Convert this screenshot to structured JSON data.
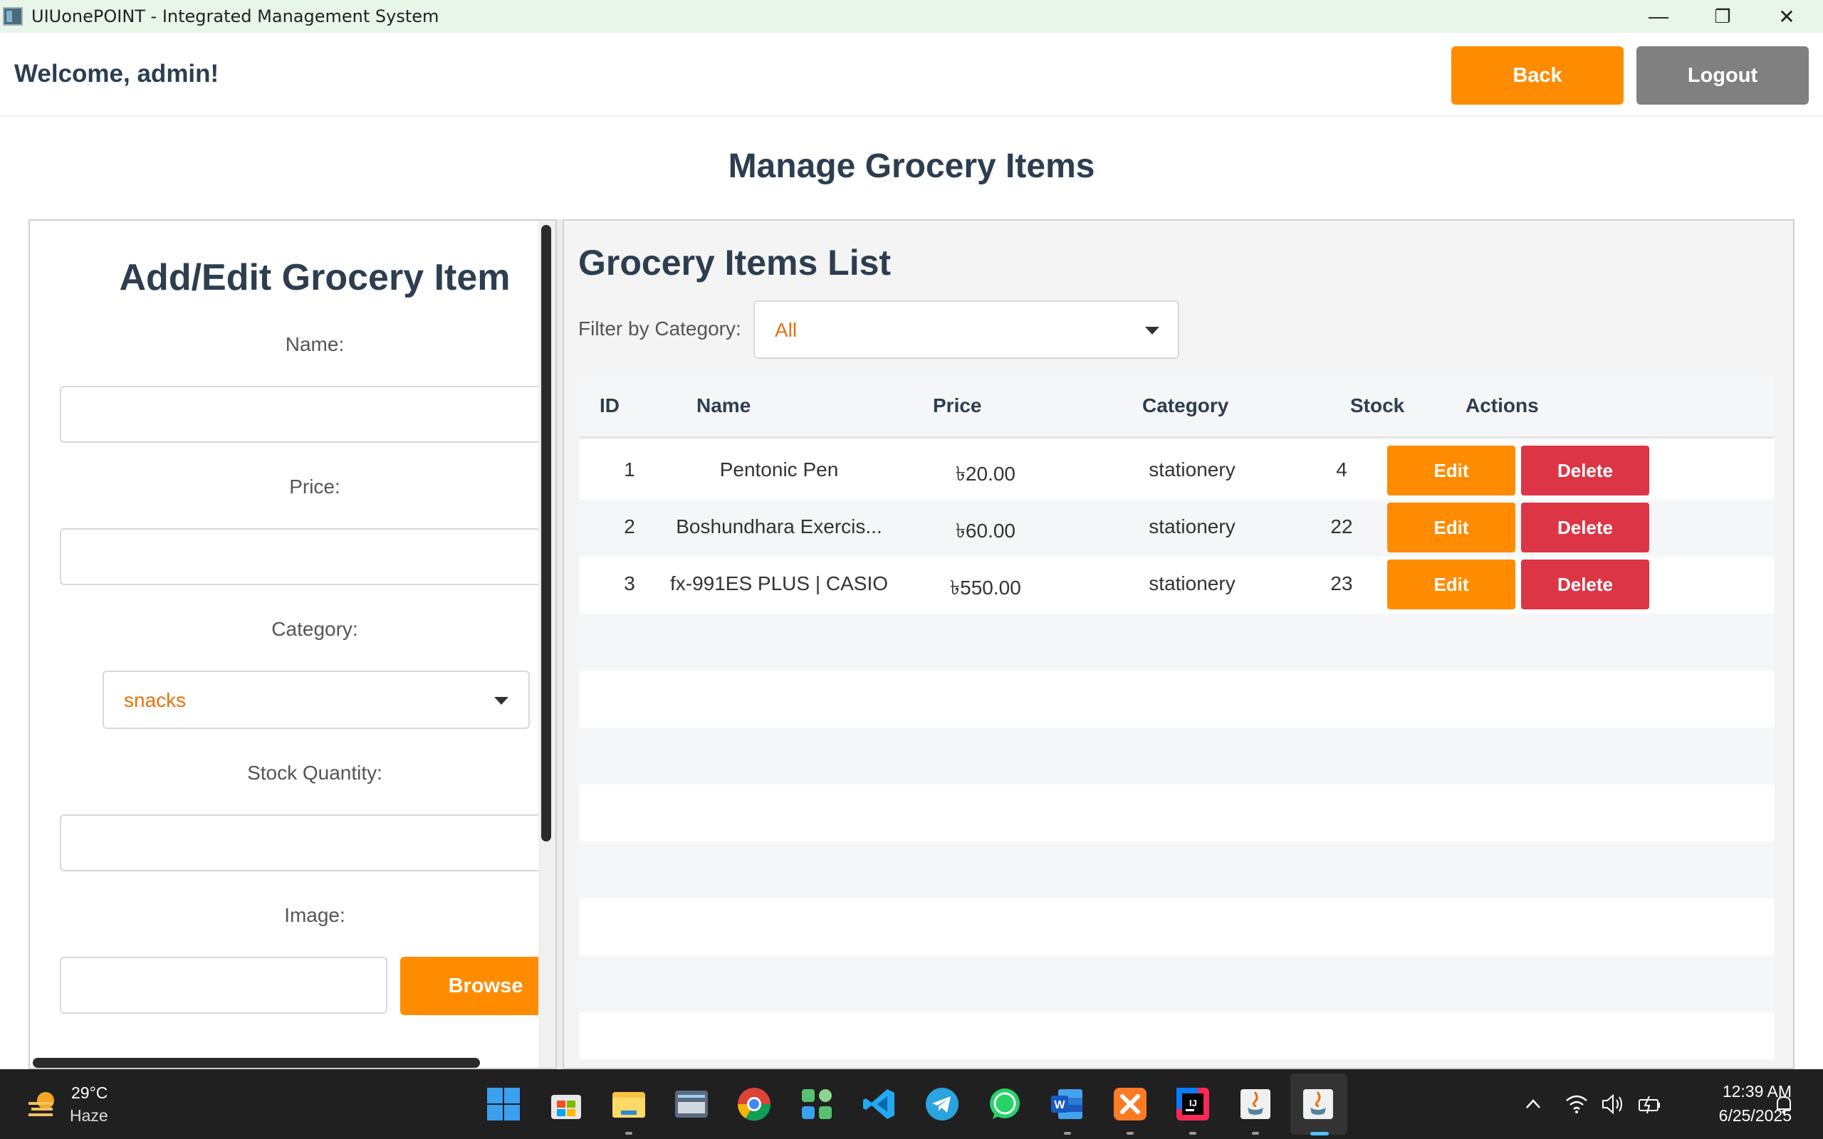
{
  "window": {
    "title": "UIUonePOINT - Integrated Management System",
    "minimize_glyph": "—",
    "restore_glyph": "❐",
    "close_glyph": "✕"
  },
  "header": {
    "welcome": "Welcome, admin!",
    "back_label": "Back",
    "logout_label": "Logout"
  },
  "page_title": "Manage Grocery Items",
  "form": {
    "title": "Add/Edit Grocery Item",
    "name_label": "Name:",
    "name_value": "",
    "price_label": "Price:",
    "price_value": "",
    "category_label": "Category:",
    "category_value": "snacks",
    "stock_label": "Stock Quantity:",
    "stock_value": "",
    "image_label": "Image:",
    "image_value": "",
    "browse_label": "Browse"
  },
  "list": {
    "title": "Grocery Items List",
    "filter_label": "Filter by Category:",
    "filter_value": "All",
    "columns": [
      "ID",
      "Name",
      "Price",
      "Category",
      "Stock",
      "Actions"
    ],
    "rows": [
      {
        "id": "1",
        "name": "Pentonic Pen",
        "price": "৳20.00",
        "category": "stationery",
        "stock": "4"
      },
      {
        "id": "2",
        "name": "Boshundhara Exercis...",
        "price": "৳60.00",
        "category": "stationery",
        "stock": "22"
      },
      {
        "id": "3",
        "name": "fx-991ES PLUS | CASIO",
        "price": "৳550.00",
        "category": "stationery",
        "stock": "23"
      }
    ],
    "edit_label": "Edit",
    "delete_label": "Delete"
  },
  "taskbar": {
    "weather_temp": "29°C",
    "weather_desc": "Haze",
    "time": "12:39 AM",
    "date": "6/25/2025",
    "apps": [
      "start-icon",
      "store-icon",
      "file-explorer-icon",
      "keyboard-app-icon",
      "chrome-icon",
      "app-grid-icon",
      "vscode-icon",
      "telegram-icon",
      "whatsapp-icon",
      "word-icon",
      "xampp-icon",
      "intellij-icon",
      "java-icon",
      "java-active-icon"
    ]
  },
  "colors": {
    "accent": "#ff8c00",
    "danger": "#dc3545",
    "neutral": "#808080",
    "heading": "#2c3e50"
  }
}
